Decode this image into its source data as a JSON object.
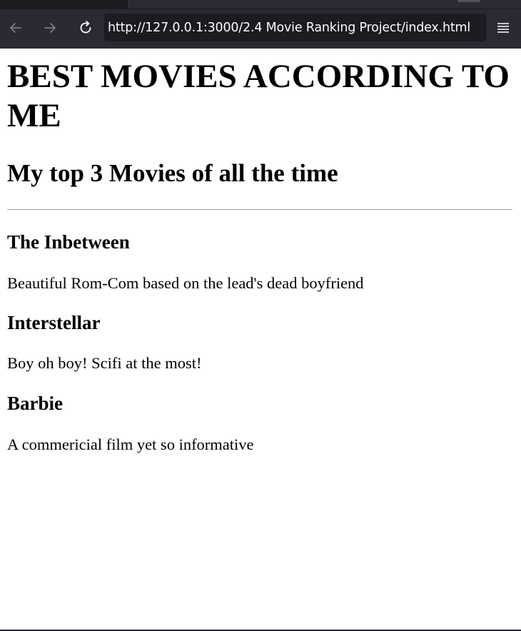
{
  "browser": {
    "url": "http://127.0.0.1:3000/2.4 Movie Ranking Project/index.html",
    "back_icon": "arrow-left-icon",
    "forward_icon": "arrow-right-icon",
    "reload_icon": "reload-icon",
    "menu_icon": "hamburger-menu-icon",
    "chrome_color": "#2b2a33",
    "url_bar_color": "#1c1b22"
  },
  "page": {
    "heading": "BEST MOVIES ACCORDING TO ME",
    "subheading": "My top 3 Movies of all the time",
    "movies": [
      {
        "title": "The Inbetween",
        "description": "Beautiful Rom-Com based on the lead's dead boyfriend"
      },
      {
        "title": "Interstellar",
        "description": "Boy oh boy! Scifi at the most!"
      },
      {
        "title": "Barbie",
        "description": "A commericial film yet so informative"
      }
    ]
  }
}
